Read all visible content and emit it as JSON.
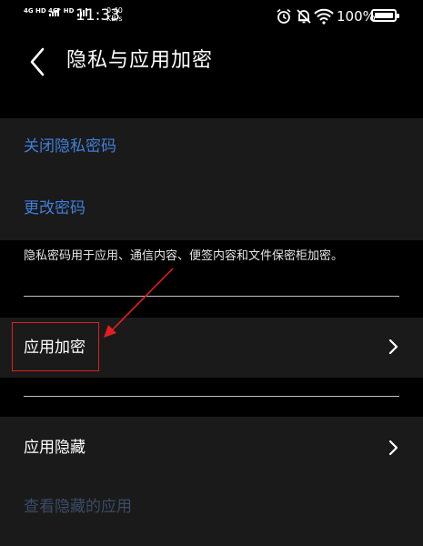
{
  "status_bar": {
    "network_1": "4G HD",
    "network_2": "4G⁺ HD",
    "time": "11:33",
    "speed_value": "0.40",
    "speed_unit": "KB/s",
    "battery": "100%",
    "icons": [
      "alarm-icon",
      "mute-bell-icon",
      "wifi-icon",
      "battery-icon"
    ]
  },
  "header": {
    "title": "隐私与应用加密",
    "back_icon": "chevron-left-icon"
  },
  "privacy_password": {
    "close_label": "关闭隐私密码",
    "change_label": "更改密码",
    "note": "隐私密码用于应用、通信内容、便签内容和文件保密柜加密。"
  },
  "items": {
    "app_encryption": "应用加密",
    "app_hide": "应用隐藏",
    "view_hidden": "查看隐藏的应用"
  },
  "colors": {
    "background": "#000000",
    "panel": "#1a1a1a",
    "link": "#3f7fd8",
    "disabled_link": "#3a4c66",
    "annotation": "#e02020"
  }
}
